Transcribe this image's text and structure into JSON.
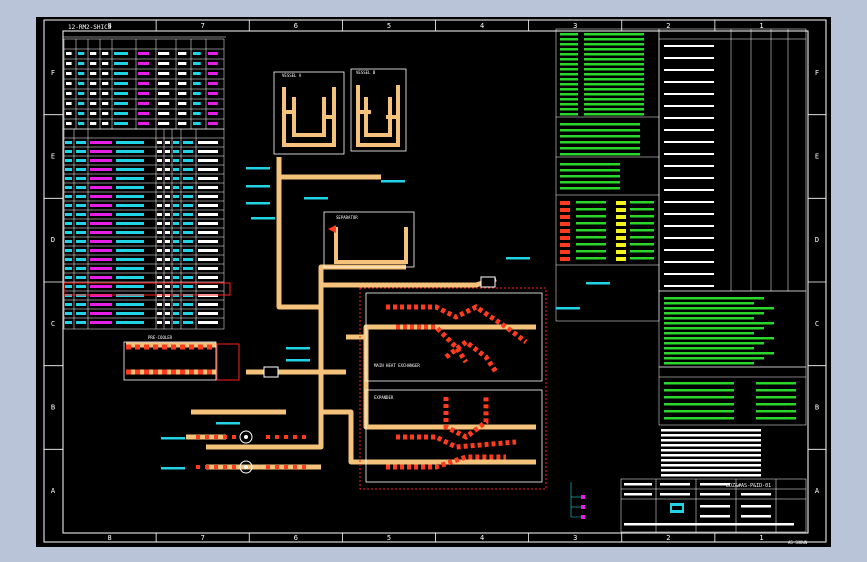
{
  "colors": {
    "background": "#000000",
    "frame": "#ffffff",
    "pipe": "#f4c27a",
    "pipe_hot": "#ff3b1f",
    "cyan": "#22d3e6",
    "green": "#2bd62b",
    "magenta": "#e61ee6",
    "red_highlight": "#ff2020",
    "yellow": "#f2f21e"
  },
  "grid": {
    "columns": [
      "8",
      "7",
      "6",
      "5",
      "4",
      "3",
      "2",
      "1"
    ],
    "rows": [
      "F",
      "E",
      "D",
      "C",
      "B",
      "A"
    ]
  },
  "tables": {
    "top_left_title": "12-RM2-SHIC3",
    "drawing_number": "LOZ&#AS-P&ID-01",
    "scale_label": "AS SHOWN",
    "revision": "A"
  },
  "icons": {
    "pump_1": "pump-icon",
    "pump_2": "pump-icon",
    "valve": "valve-icon",
    "company_logo": "logo-icon"
  },
  "labels": {
    "cold_box": "PRE-COOLER",
    "main_cooler": "MAIN HEAT EXCHANGER",
    "vessel_a": "VESSEL A",
    "vessel_b": "VESSEL B",
    "expander": "EXPANDER",
    "separator": "SEPARATOR"
  }
}
